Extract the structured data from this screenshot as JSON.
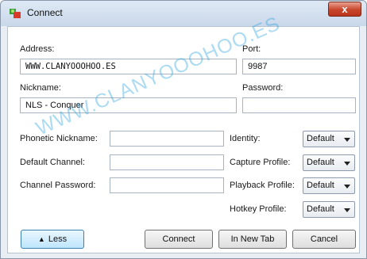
{
  "window": {
    "title": "Connect",
    "close_label": "x"
  },
  "form": {
    "address_label": "Address:",
    "address_value": "WWW.CLANYOOOHOO.ES",
    "port_label": "Port:",
    "port_value": "9987",
    "nickname_label": "Nickname:",
    "nickname_value": "NLS - Conquer",
    "password_label": "Password:",
    "password_value": "",
    "phonetic_label": "Phonetic Nickname:",
    "phonetic_value": "",
    "channel_label": "Default Channel:",
    "channel_value": "",
    "channel_password_label": "Channel Password:",
    "channel_password_value": ""
  },
  "profiles": {
    "identity_label": "Identity:",
    "identity_value": "Default",
    "capture_label": "Capture Profile:",
    "capture_value": "Default",
    "playback_label": "Playback Profile:",
    "playback_value": "Default",
    "hotkey_label": "Hotkey Profile:",
    "hotkey_value": "Default"
  },
  "buttons": {
    "less_label": "Less",
    "connect_label": "Connect",
    "new_tab_label": "In New Tab",
    "cancel_label": "Cancel"
  },
  "watermark": "WWW.CLANYOOOHOO.ES",
  "colors": {
    "close_button": "#c8452b",
    "watermark": "#28a0dc",
    "less_button": "#bee6fd"
  }
}
